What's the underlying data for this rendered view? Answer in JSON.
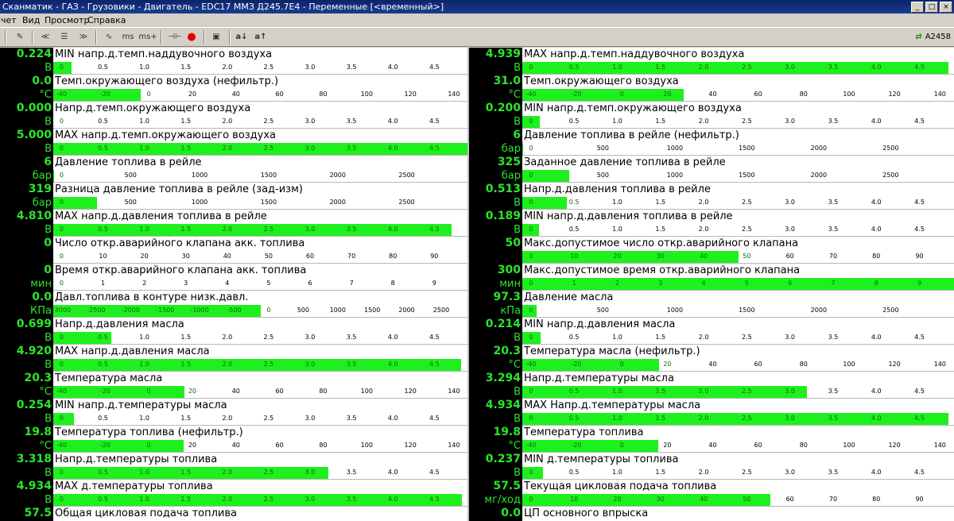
{
  "window": {
    "title": "Сканматик - ГАЗ - Грузовики - Двигатель - EDC17 ММЗ Д245.7Е4 - Переменные [<временный>]",
    "buttons": [
      "_",
      "□",
      "×"
    ]
  },
  "menu": [
    "чет",
    "Вид",
    "Просмотр",
    "Справка"
  ],
  "toolbar": {
    "buttons": [
      {
        "icon": "edit-icon",
        "glyph": "✎"
      },
      {
        "icon": "rewind-icon",
        "glyph": "≪"
      },
      {
        "icon": "list-icon",
        "glyph": "☰"
      },
      {
        "icon": "forward-icon",
        "glyph": "≫"
      },
      {
        "icon": "wave-icon",
        "glyph": "∿"
      },
      {
        "icon": "ms-icon",
        "glyph": "ms"
      },
      {
        "icon": "ms-plus-icon",
        "glyph": "ms+"
      },
      {
        "icon": "probe-icon",
        "glyph": "⊣⊢"
      },
      {
        "icon": "record-icon",
        "glyph": "●"
      },
      {
        "icon": "save-icon",
        "glyph": "▣"
      },
      {
        "icon": "font-decrease-icon",
        "glyph": "a↓"
      },
      {
        "icon": "font-increase-icon",
        "glyph": "a↑"
      }
    ],
    "connection": "A2458"
  },
  "colors": {
    "value_bg": "#000000",
    "value_text": "#2de32d",
    "bar": "#1ef01e",
    "record": "#e00000"
  },
  "scales": {
    "v": {
      "ticks": [
        "0",
        "0.5",
        "1.0",
        "1.5",
        "2.0",
        "2.5",
        "3.0",
        "3.5",
        "4.0",
        "4.5"
      ],
      "min": 0,
      "max": 5
    },
    "t": {
      "ticks": [
        "-40",
        "-20",
        "0",
        "20",
        "40",
        "60",
        "80",
        "100",
        "120",
        "140"
      ],
      "min": -40,
      "max": 150
    },
    "bar": {
      "ticks": [
        "0",
        "500",
        "1000",
        "1500",
        "2000",
        "2500"
      ],
      "min": 0,
      "max": 3000
    },
    "cnt": {
      "ticks": [
        "0",
        "10",
        "20",
        "30",
        "40",
        "50",
        "60",
        "70",
        "80",
        "90"
      ],
      "min": 0,
      "max": 100
    },
    "min": {
      "ticks": [
        "0",
        "1",
        "2",
        "3",
        "4",
        "5",
        "6",
        "7",
        "8",
        "9"
      ],
      "min": 0,
      "max": 10
    },
    "kpa": {
      "ticks": [
        "-3000",
        "-2500",
        "-2000",
        "-1500",
        "-1000",
        "-500",
        "0",
        "500",
        "1000",
        "1500",
        "2000",
        "2500",
        "3000"
      ],
      "min": -3000,
      "max": 3000
    }
  },
  "params": {
    "left": [
      {
        "value": "0.224",
        "unit": "В",
        "label": "MIN напр.д.темп.наддувочного воздуха",
        "scale": "v",
        "level": 0.224
      },
      {
        "value": "0.0",
        "unit": "°С",
        "label": "Темп.окружающего воздуха (нефильтр.)",
        "scale": "t",
        "level": 0
      },
      {
        "value": "0.000",
        "unit": "В",
        "label": "Напр.д.темп.окружающего воздуха",
        "scale": "v",
        "level": 0
      },
      {
        "value": "5.000",
        "unit": "В",
        "label": "MAX напр.д.темп.окружающего воздуха",
        "scale": "v",
        "level": 5
      },
      {
        "value": "6",
        "unit": "бар",
        "label": "Давление топлива в рейле",
        "scale": "bar",
        "level": 6
      },
      {
        "value": "319",
        "unit": "бар",
        "label": "Разница давление топлива в рейле (зад-изм)",
        "scale": "bar",
        "level": 319
      },
      {
        "value": "4.810",
        "unit": "В",
        "label": "MAX напр.д.давления топлива в рейле",
        "scale": "v",
        "level": 4.81
      },
      {
        "value": "0",
        "unit": "",
        "label": "Число откр.аварийного клапана акк. топлива",
        "scale": "cnt",
        "level": 0
      },
      {
        "value": "0",
        "unit": "мин",
        "label": "Время откр.аварийного клапана акк. топлива",
        "scale": "min",
        "level": 0
      },
      {
        "value": "0.0",
        "unit": "КПа",
        "label": "Давл.топлива в контуре низк.давл.",
        "scale": "kpa",
        "level": 0
      },
      {
        "value": "0.699",
        "unit": "В",
        "label": "Напр.д.давления масла",
        "scale": "v",
        "level": 0.699
      },
      {
        "value": "4.920",
        "unit": "В",
        "label": "MAX напр.д.давления масла",
        "scale": "v",
        "level": 4.92
      },
      {
        "value": "20.3",
        "unit": "°С",
        "label": "Температура масла",
        "scale": "t",
        "level": 20.3
      },
      {
        "value": "0.254",
        "unit": "В",
        "label": "MIN напр.д.температуры масла",
        "scale": "v",
        "level": 0.254
      },
      {
        "value": "19.8",
        "unit": "°С",
        "label": "Температура топлива (нефильтр.)",
        "scale": "t",
        "level": 19.8
      },
      {
        "value": "3.318",
        "unit": "В",
        "label": "Напр.д.температуры топлива",
        "scale": "v",
        "level": 3.318
      },
      {
        "value": "4.934",
        "unit": "В",
        "label": "MAX д.температуры топлива",
        "scale": "v",
        "level": 4.934
      },
      {
        "value": "57.5",
        "unit": "",
        "label": "Общая цикловая подача топлива",
        "scale": "cnt",
        "level": 57.5
      }
    ],
    "right": [
      {
        "value": "4.939",
        "unit": "В",
        "label": "MAX напр.д.темп.наддувочного воздуха",
        "scale": "v",
        "level": 4.939
      },
      {
        "value": "31.0",
        "unit": "°С",
        "label": "Темп.окружающего воздуха",
        "scale": "t",
        "level": 31
      },
      {
        "value": "0.200",
        "unit": "В",
        "label": "MIN напр.д.темп.окружающего воздуха",
        "scale": "v",
        "level": 0.2
      },
      {
        "value": "6",
        "unit": "бар",
        "label": "Давление топлива в рейле (нефильтр.)",
        "scale": "bar",
        "level": 6
      },
      {
        "value": "325",
        "unit": "бар",
        "label": "Заданное давление топлива в рейле",
        "scale": "bar",
        "level": 325
      },
      {
        "value": "0.513",
        "unit": "В",
        "label": "Напр.д.давления топлива в рейле",
        "scale": "v",
        "level": 0.513
      },
      {
        "value": "0.189",
        "unit": "В",
        "label": "MIN напр.д.давления топлива в рейле",
        "scale": "v",
        "level": 0.189
      },
      {
        "value": "50",
        "unit": "",
        "label": "Макс.допустимое число откр.аварийного клапана",
        "scale": "cnt",
        "level": 50
      },
      {
        "value": "300",
        "unit": "мин",
        "label": "Макс.допустимое время откр.аварийного клапана",
        "scale": "min",
        "level": 300
      },
      {
        "value": "97.3",
        "unit": "кПа",
        "label": "Давление масла",
        "scale": "bar",
        "level": 97.3
      },
      {
        "value": "0.214",
        "unit": "В",
        "label": "MIN напр.д.давления масла",
        "scale": "v",
        "level": 0.214
      },
      {
        "value": "20.3",
        "unit": "°С",
        "label": "Температура масла (нефильтр.)",
        "scale": "t",
        "level": 20.3
      },
      {
        "value": "3.294",
        "unit": "В",
        "label": "Напр.д.температуры масла",
        "scale": "v",
        "level": 3.294
      },
      {
        "value": "4.934",
        "unit": "В",
        "label": "MAX Напр.д.температуры масла",
        "scale": "v",
        "level": 4.934
      },
      {
        "value": "19.8",
        "unit": "°С",
        "label": "Температура топлива",
        "scale": "t",
        "level": 19.8
      },
      {
        "value": "0.237",
        "unit": "В",
        "label": "MIN д.температуры топлива",
        "scale": "v",
        "level": 0.237
      },
      {
        "value": "57.5",
        "unit": "мг/ход",
        "label": "Текущая цикловая подача топлива",
        "scale": "cnt",
        "level": 57.5
      },
      {
        "value": "0.0",
        "unit": "",
        "label": "ЦП основного впрыска",
        "scale": "cnt",
        "level": 0
      }
    ]
  }
}
